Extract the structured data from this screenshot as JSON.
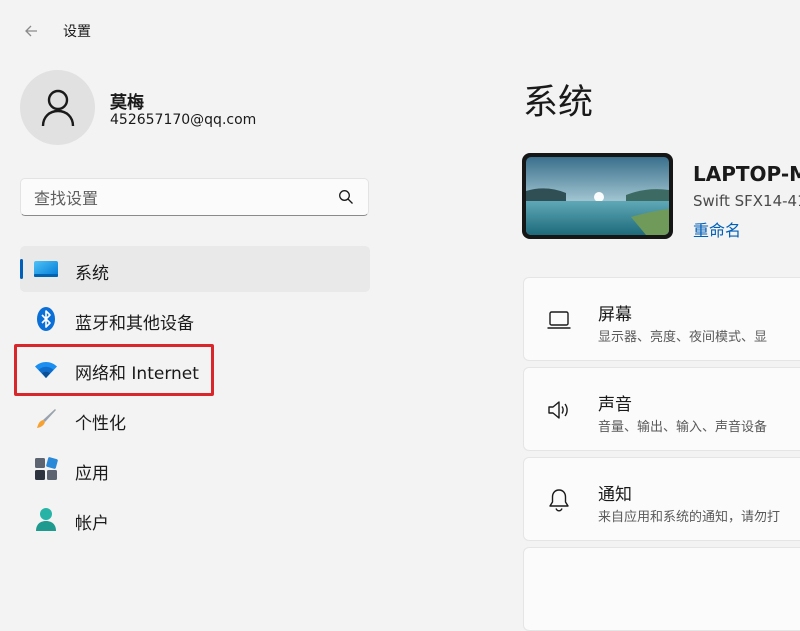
{
  "app": {
    "title": "设置"
  },
  "user": {
    "name": "莫梅",
    "email": "452657170@qq.com"
  },
  "search": {
    "placeholder": "查找设置"
  },
  "sidebar": {
    "items": [
      {
        "label": "系统",
        "icon": "system-monitor-icon",
        "active": true
      },
      {
        "label": "蓝牙和其他设备",
        "icon": "bluetooth-icon"
      },
      {
        "label": "网络和 Internet",
        "icon": "wifi-icon",
        "highlighted": true
      },
      {
        "label": "个性化",
        "icon": "paintbrush-icon"
      },
      {
        "label": "应用",
        "icon": "apps-icon"
      },
      {
        "label": "帐户",
        "icon": "account-icon"
      }
    ]
  },
  "main": {
    "title": "系统",
    "device": {
      "name": "LAPTOP-M",
      "model": "Swift SFX14-41",
      "rename_label": "重命名"
    },
    "cards": [
      {
        "title": "屏幕",
        "desc": "显示器、亮度、夜间模式、显",
        "icon": "display-icon"
      },
      {
        "title": "声音",
        "desc": "音量、输出、输入、声音设备",
        "icon": "speaker-icon"
      },
      {
        "title": "通知",
        "desc": "来自应用和系统的通知，请勿打",
        "icon": "bell-icon"
      }
    ]
  },
  "colors": {
    "accent": "#005fb8",
    "highlight_border": "#d9262b",
    "background": "#f3f3f3"
  }
}
